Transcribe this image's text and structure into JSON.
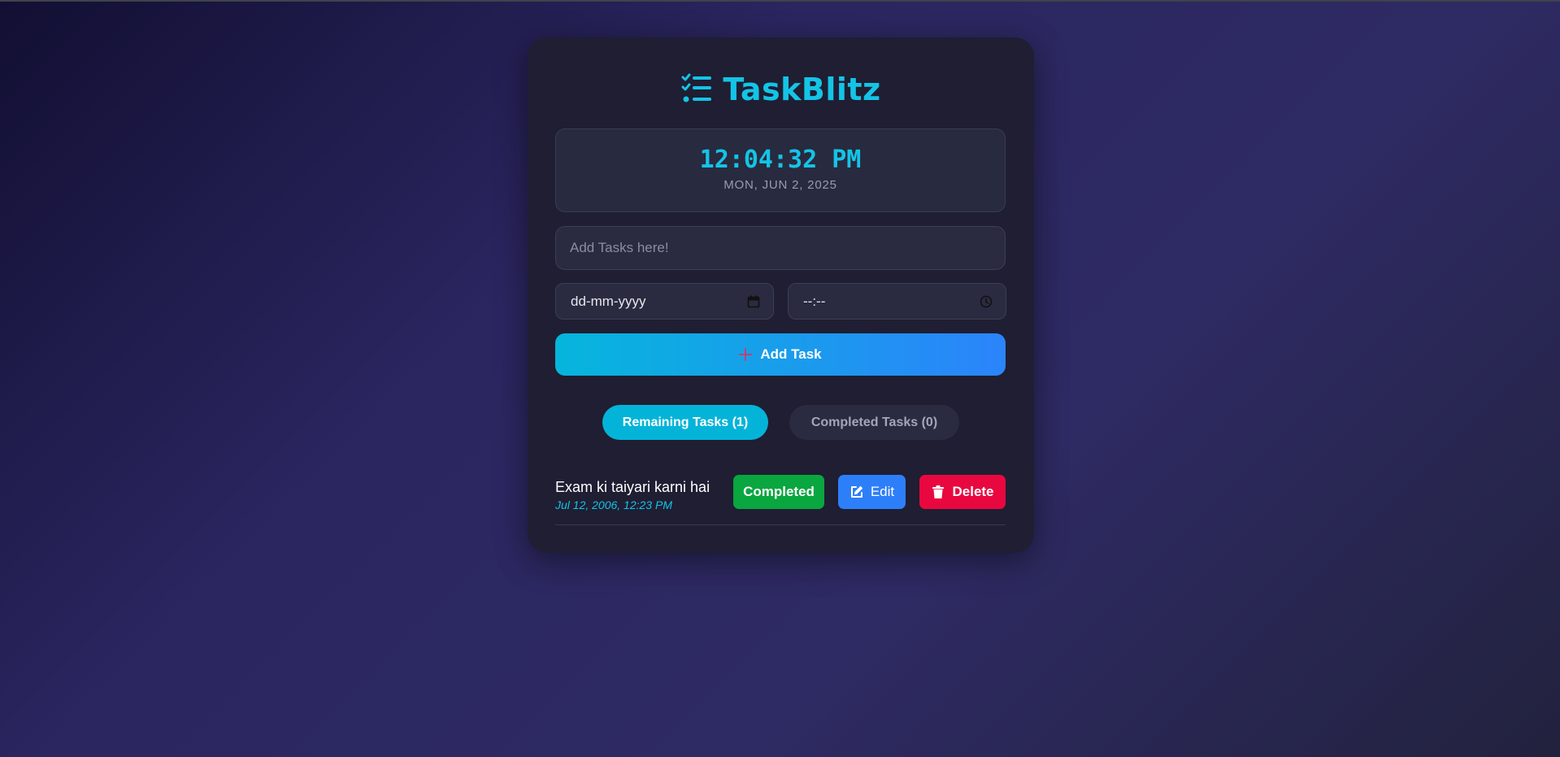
{
  "app": {
    "title": "TaskBlitz",
    "logo_icon": "list-check-icon",
    "accent_color": "#14c4e6"
  },
  "clock": {
    "time": "12:04:32 PM",
    "date": "MON, JUN 2, 2025"
  },
  "form": {
    "task_placeholder": "Add Tasks here!",
    "task_value": "",
    "date_placeholder": "dd-mm-yyyy",
    "time_placeholder": "--:--",
    "date_icon": "calendar-icon",
    "time_icon": "clock-icon",
    "add_button_label": "Add Task",
    "add_button_icon": "plus-icon"
  },
  "tabs": [
    {
      "label": "Remaining Tasks (1)",
      "active": true
    },
    {
      "label": "Completed Tasks (0)",
      "active": false
    }
  ],
  "tasks": [
    {
      "title": "Exam ki taiyari karni hai",
      "due": "Jul 12, 2006, 12:23 PM",
      "complete_label": "Completed",
      "edit_label": "Edit",
      "edit_icon": "edit-icon",
      "delete_label": "Delete",
      "delete_icon": "trash-icon"
    }
  ],
  "colors": {
    "complete": "#0aa63f",
    "edit": "#2d7ff9",
    "delete": "#e8083f"
  }
}
